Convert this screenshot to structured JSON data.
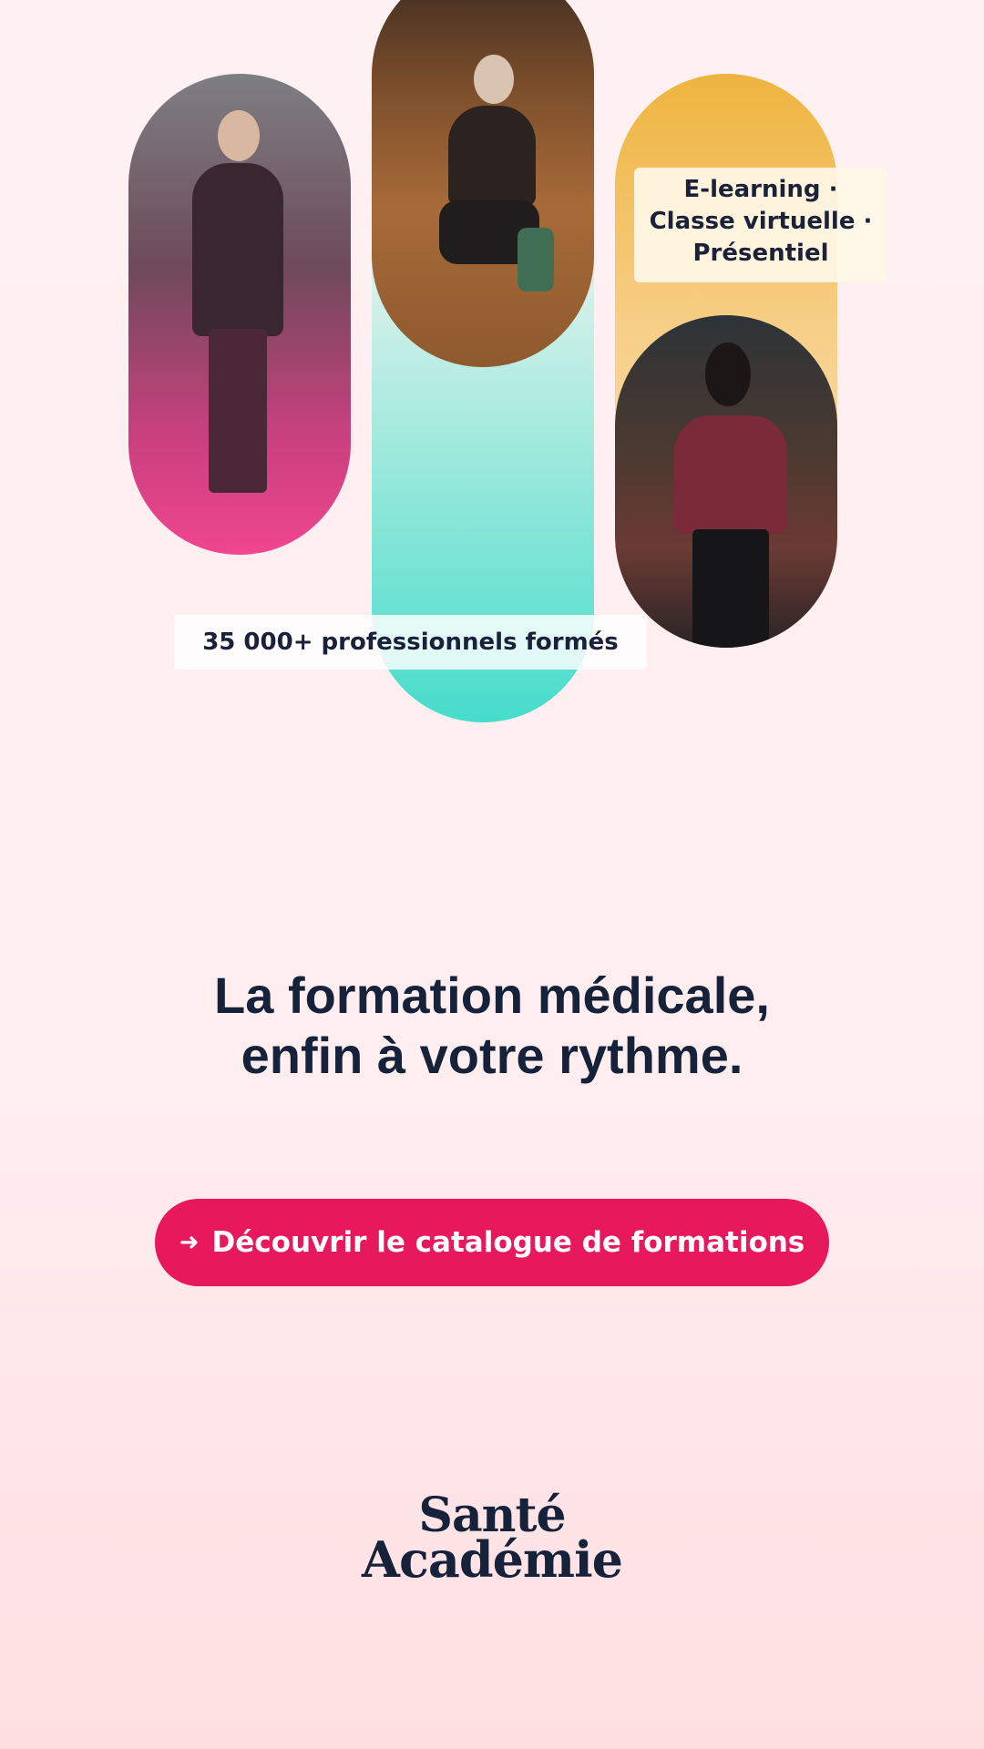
{
  "badges": {
    "students": "35 000+ professionnels formés",
    "modes": [
      "E-learning ·",
      "Classe virtuelle ·",
      "Présentiel"
    ]
  },
  "headline": {
    "line1": "La formation médicale,",
    "line2": "enfin à votre rythme."
  },
  "cta": {
    "icon": "arrow-right-icon",
    "label": "Découvrir le catalogue de formations"
  },
  "logo": {
    "line1": "Santé",
    "line2": "Académie"
  },
  "colors": {
    "accent": "#e8185d",
    "text": "#16213a",
    "teal": "#46dccb",
    "pink": "#f0468e",
    "yellow": "#eeb43e"
  }
}
